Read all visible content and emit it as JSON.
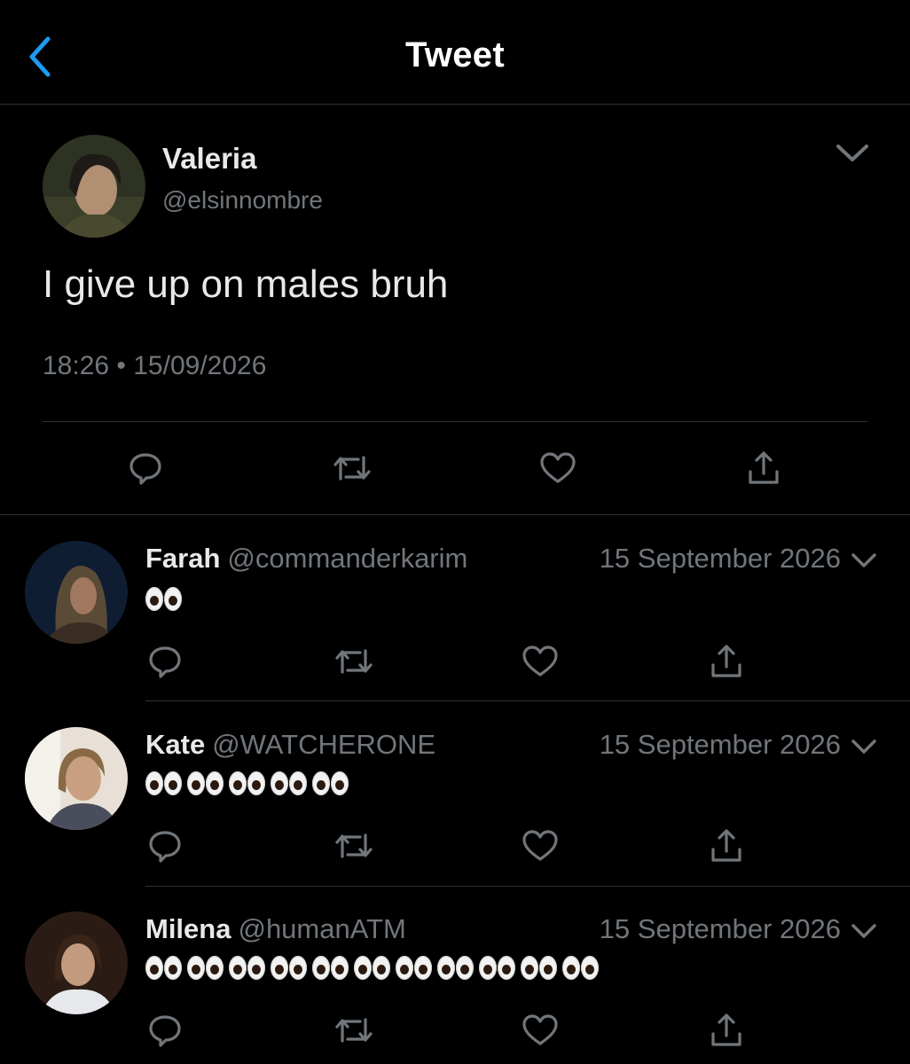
{
  "header": {
    "title": "Tweet"
  },
  "tweet": {
    "name": "Valeria",
    "handle": "@elsinnombre",
    "text": "I give up on males bruh",
    "timestamp": "18:26 • 15/09/2026"
  },
  "replies": [
    {
      "name": "Farah",
      "handle": "@commanderkarim",
      "date": "15 September 2026",
      "eyes_count": 1
    },
    {
      "name": "Kate",
      "handle": "@WATCHERONE",
      "date": "15 September 2026",
      "eyes_count": 5
    },
    {
      "name": "Milena",
      "handle": "@humanATM",
      "date": "15 September 2026",
      "eyes_count": 11
    }
  ],
  "colors": {
    "accent": "#1d9bf0",
    "background": "#000000",
    "secondary_text": "#71767b",
    "divider": "#2f3336"
  },
  "icons": [
    "back-chevron-icon",
    "chevron-down-icon",
    "reply-icon",
    "retweet-icon",
    "like-icon",
    "share-icon"
  ]
}
